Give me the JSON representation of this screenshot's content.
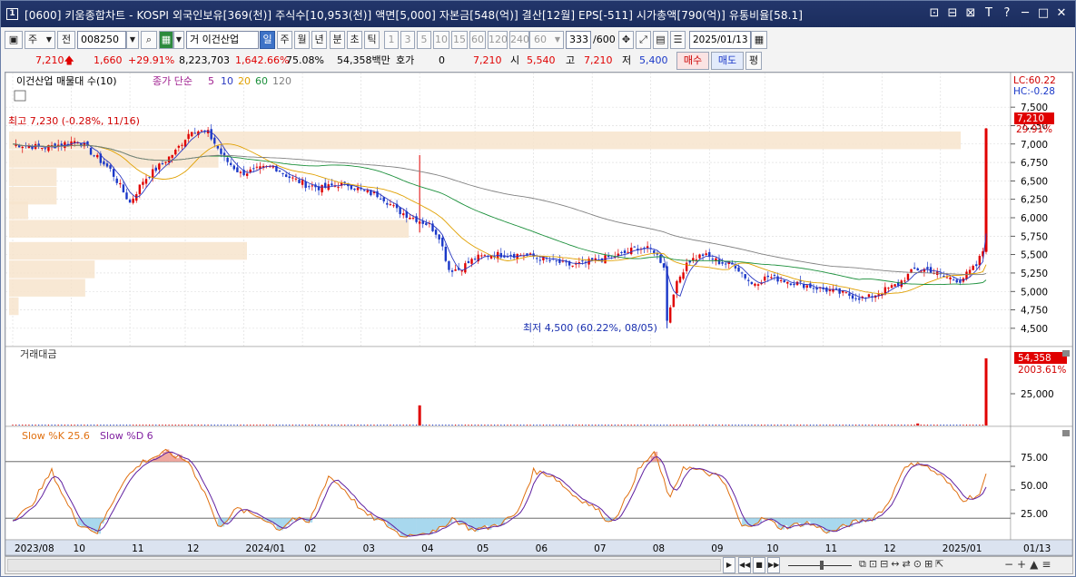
{
  "window": {
    "icon_label": "1",
    "title": "[0600] 키움종합차트 - KOSPI 외국인보유[369(천)] 주식수[10,953(천)] 액면[5,000] 자본금[548(억)] 결산[12월] EPS[-511] 시가총액[790(억)] 유통비율[58.1]",
    "title_buttons": [
      "⊡",
      "⊟",
      "⊠",
      "T",
      "?",
      "─",
      "□",
      "✕"
    ]
  },
  "toolbar": {
    "period_select": "주",
    "jeon": "전",
    "code": "008250",
    "name_prefix": "거",
    "stock_name": "이건산업",
    "periods": [
      "일",
      "주",
      "월",
      "년",
      "분",
      "초",
      "틱"
    ],
    "active_period": "일",
    "minutes": [
      "1",
      "3",
      "5",
      "10",
      "15",
      "60",
      "120",
      "240"
    ],
    "minute_select": "60",
    "count": "333",
    "count_total": "/600",
    "date": "2025/01/13"
  },
  "quote": {
    "price": "7,210",
    "change": "1,660",
    "change_pct": "+29.91%",
    "volume": "8,223,703",
    "volume_pct": "1,642.66%",
    "turnover": "75.08%",
    "amount": "54,358백만",
    "hoga_label": "호가",
    "hoga_value": "0",
    "bid": "7,210",
    "open_label": "시",
    "open": "5,540",
    "high_label": "고",
    "high": "7,210",
    "low_label": "저",
    "low": "5,400",
    "buy_label": "매수",
    "sell_label": "매도",
    "avg_label": "평"
  },
  "legend": {
    "stock": "이건산업 매물대 수(10)",
    "ma_label": "종가 단순",
    "ma": [
      "5",
      "10",
      "20",
      "60",
      "120"
    ],
    "ma_colors": [
      "#2a38c0",
      "#2a38c0",
      "#e0a000",
      "#1a8f3a",
      "#808080"
    ],
    "lc": "LC:60.22",
    "hc": "HC:-0.28"
  },
  "annotations": {
    "high": "최고 7,230 (-0.28%, 11/16)",
    "low": "최저 4,500 (60.22%, 08/05)"
  },
  "price_axis": {
    "ticks": [
      "7,500",
      "7,250",
      "7,000",
      "6,750",
      "6,500",
      "6,250",
      "6,000",
      "5,750",
      "5,500",
      "5,250",
      "5,000",
      "4,750",
      "4,500"
    ],
    "last_price": "7,210",
    "last_pct": "29.91%"
  },
  "volume_panel": {
    "title": "거래대금",
    "tick": "25,000",
    "last_value": "54,358",
    "last_pct": "2003.61%"
  },
  "stoch_panel": {
    "title_k": "Slow %K 25.6",
    "title_d": "Slow %D 6",
    "ticks": [
      "75.00",
      "50.00",
      "25.00"
    ],
    "levels": [
      80,
      20
    ]
  },
  "x_axis": {
    "labels": [
      "2023/08",
      "10",
      "11",
      "12",
      "2024/01",
      "02",
      "03",
      "04",
      "05",
      "06",
      "07",
      "08",
      "09",
      "10",
      "11",
      "12",
      "2025/01"
    ],
    "right_label": "01/13"
  },
  "chart_data": {
    "type": "candlestick",
    "ylim": [
      4400,
      7600
    ],
    "volume_profile": [
      {
        "price": 7050,
        "len": 1.0
      },
      {
        "price": 6800,
        "len": 0.22
      },
      {
        "price": 6550,
        "len": 0.05
      },
      {
        "price": 6300,
        "len": 0.05
      },
      {
        "price": 6100,
        "len": 0.02
      },
      {
        "price": 5850,
        "len": 0.42
      },
      {
        "price": 5550,
        "len": 0.25
      },
      {
        "price": 5300,
        "len": 0.09
      },
      {
        "price": 5050,
        "len": 0.08
      },
      {
        "price": 4800,
        "len": 0.01
      }
    ],
    "close_path": [
      [
        0,
        7000
      ],
      [
        10,
        6950
      ],
      [
        20,
        7050
      ],
      [
        30,
        6650
      ],
      [
        36,
        6200
      ],
      [
        40,
        6500
      ],
      [
        50,
        6900
      ],
      [
        55,
        7200
      ],
      [
        60,
        7150
      ],
      [
        65,
        6800
      ],
      [
        70,
        6600
      ],
      [
        75,
        6650
      ],
      [
        80,
        6700
      ],
      [
        85,
        6550
      ],
      [
        90,
        6450
      ],
      [
        95,
        6400
      ],
      [
        100,
        6450
      ],
      [
        103,
        6450
      ],
      [
        108,
        6350
      ],
      [
        113,
        6300
      ],
      [
        118,
        6100
      ],
      [
        123,
        6000
      ],
      [
        128,
        5900
      ],
      [
        131,
        5750
      ],
      [
        134,
        5300
      ],
      [
        137,
        5300
      ],
      [
        142,
        5450
      ],
      [
        147,
        5500
      ],
      [
        152,
        5500
      ],
      [
        157,
        5500
      ],
      [
        162,
        5450
      ],
      [
        167,
        5400
      ],
      [
        172,
        5350
      ],
      [
        177,
        5400
      ],
      [
        182,
        5450
      ],
      [
        187,
        5500
      ],
      [
        192,
        5600
      ],
      [
        197,
        5550
      ],
      [
        200,
        5350
      ],
      [
        201,
        4600
      ],
      [
        203,
        5000
      ],
      [
        207,
        5400
      ],
      [
        212,
        5500
      ],
      [
        217,
        5400
      ],
      [
        222,
        5350
      ],
      [
        227,
        5100
      ],
      [
        232,
        5200
      ],
      [
        237,
        5150
      ],
      [
        242,
        5100
      ],
      [
        247,
        5050
      ],
      [
        252,
        5000
      ],
      [
        257,
        4950
      ],
      [
        262,
        4900
      ],
      [
        267,
        5000
      ],
      [
        272,
        5100
      ],
      [
        277,
        5300
      ],
      [
        281,
        5300
      ],
      [
        286,
        5200
      ],
      [
        291,
        5150
      ],
      [
        296,
        5350
      ],
      [
        298,
        5550
      ],
      [
        299,
        7210
      ]
    ],
    "stoch_path": [
      [
        0,
        20
      ],
      [
        5,
        30
      ],
      [
        12,
        70
      ],
      [
        16,
        40
      ],
      [
        20,
        15
      ],
      [
        26,
        5
      ],
      [
        34,
        60
      ],
      [
        40,
        80
      ],
      [
        47,
        90
      ],
      [
        54,
        80
      ],
      [
        60,
        40
      ],
      [
        63,
        10
      ],
      [
        69,
        30
      ],
      [
        77,
        20
      ],
      [
        82,
        8
      ],
      [
        86,
        20
      ],
      [
        91,
        15
      ],
      [
        97,
        65
      ],
      [
        102,
        50
      ],
      [
        108,
        25
      ],
      [
        114,
        15
      ],
      [
        120,
        0
      ],
      [
        125,
        5
      ],
      [
        130,
        5
      ],
      [
        135,
        20
      ],
      [
        141,
        8
      ],
      [
        146,
        10
      ],
      [
        150,
        15
      ],
      [
        155,
        25
      ],
      [
        160,
        70
      ],
      [
        166,
        65
      ],
      [
        172,
        45
      ],
      [
        177,
        35
      ],
      [
        181,
        25
      ],
      [
        183,
        15
      ],
      [
        187,
        30
      ],
      [
        192,
        70
      ],
      [
        197,
        90
      ],
      [
        202,
        40
      ],
      [
        206,
        75
      ],
      [
        211,
        70
      ],
      [
        216,
        65
      ],
      [
        219,
        55
      ],
      [
        224,
        10
      ],
      [
        231,
        20
      ],
      [
        236,
        10
      ],
      [
        244,
        15
      ],
      [
        251,
        5
      ],
      [
        258,
        15
      ],
      [
        264,
        20
      ],
      [
        269,
        35
      ],
      [
        273,
        70
      ],
      [
        278,
        80
      ],
      [
        285,
        65
      ],
      [
        292,
        40
      ],
      [
        297,
        45
      ],
      [
        299,
        65
      ]
    ],
    "volume_spikes": [
      [
        125,
        0.3
      ],
      [
        278,
        0.03
      ],
      [
        299,
        1.0
      ]
    ]
  }
}
